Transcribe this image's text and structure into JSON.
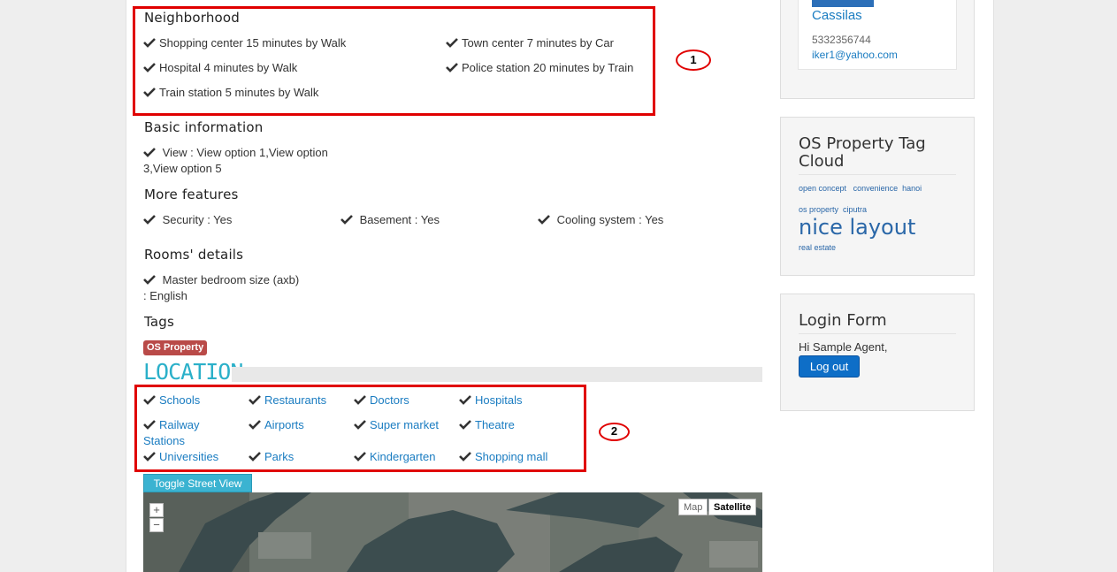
{
  "neighborhood": {
    "title": "Neighborhood",
    "items": [
      "Shopping center 15 minutes by Walk",
      "Town center 7 minutes by Car",
      "Hospital 4 minutes by Walk",
      "Police station 20 minutes by Train",
      "Train station 5 minutes by Walk"
    ]
  },
  "basic_info": {
    "title": "Basic information",
    "view_line1": "View : View option 1,View option",
    "view_line2": "3,View option 5"
  },
  "more_features": {
    "title": "More features",
    "items": [
      "Security : Yes",
      "Basement : Yes",
      "Cooling system : Yes"
    ]
  },
  "rooms": {
    "title": "Rooms' details",
    "line1": "Master bedroom size (axb)",
    "line2": ": English"
  },
  "tags": {
    "title": "Tags",
    "badge": "OS Property"
  },
  "location": {
    "heading": "LOCATION",
    "links": [
      "Schools",
      "Restaurants",
      "Doctors",
      "Hospitals",
      "Railway",
      "Airports",
      "Super market",
      "Theatre",
      "Stations",
      "Universities",
      "Parks",
      "Kindergarten",
      "Shopping mall"
    ],
    "toggle_street_view": "Toggle Street View",
    "map_type_map": "Map",
    "map_type_satellite": "Satellite",
    "zoom_in": "+",
    "zoom_out": "−"
  },
  "annotations": [
    "1",
    "2"
  ],
  "agent_card": {
    "name": "Cassilas",
    "phone": "5332356744",
    "email": "iker1@yahoo.com"
  },
  "tag_cloud": {
    "title": "OS Property Tag Cloud",
    "tags": [
      "open concept",
      "convenience",
      "hanoi",
      "os property",
      "ciputra",
      "nice layout",
      "real estate"
    ]
  },
  "login_form": {
    "title": "Login Form",
    "greeting": "Hi Sample Agent,",
    "logout": "Log out"
  },
  "colors": {
    "accent_link": "#1a7cc1",
    "annotation_red": "#e00000",
    "location_teal": "#2bb0c9",
    "tag_badge": "#b94a48",
    "logout_blue": "#0e6ec7"
  }
}
